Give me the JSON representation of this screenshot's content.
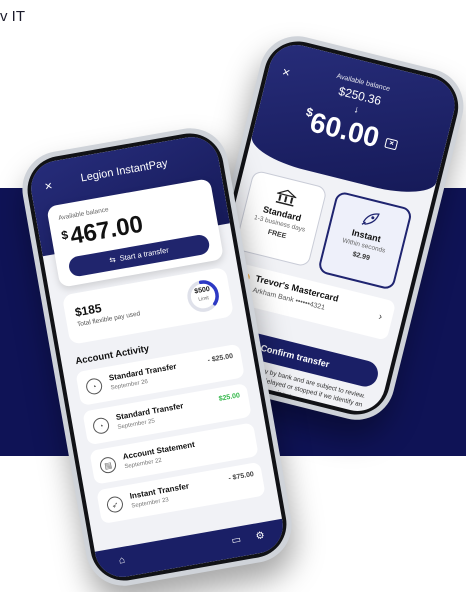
{
  "page_label": "v IT",
  "back_screen": {
    "close_icon": "×",
    "available_label": "Available balance",
    "old_balance": "$250.36",
    "arrow": "↓",
    "new_currency": "$",
    "new_amount": "60.00",
    "options": [
      {
        "title": "Standard",
        "sub": "1-3 business days",
        "price": "FREE",
        "icon": "bank-icon"
      },
      {
        "title": "Instant",
        "sub": "Within seconds",
        "price": "$2.99",
        "icon": "rocket-icon"
      }
    ],
    "card": {
      "name": "Trevor's Mastercard",
      "account": "Arkham Bank ••••••4321"
    },
    "confirm_label": "Confirm transfer",
    "disclaimer": "Transfer times vary by bank and are subject to review. Transfers may be delayed or stopped if we identify an issue."
  },
  "front_screen": {
    "title": "Legion InstantPay",
    "close_icon": "×",
    "available_label": "Available balance",
    "currency": "$",
    "balance": "467.00",
    "start_transfer_label": "Start a transfer",
    "flex_amount": "$185",
    "flex_label": "Total flexible pay used",
    "ring_value": "$500",
    "ring_sub": "Limit",
    "ring_fraction": 0.37,
    "activity_title": "Account Activity",
    "activity": [
      {
        "name": "Standard Transfer",
        "date": "September 26",
        "amount": "- $25.00",
        "tone": "neg",
        "icon": "clock-icon"
      },
      {
        "name": "Standard Transfer",
        "date": "September 25",
        "amount": "$25.00",
        "tone": "pos",
        "icon": "clock-icon"
      },
      {
        "name": "Account Statement",
        "date": "September 22",
        "amount": "",
        "tone": "neg",
        "icon": "document-icon"
      },
      {
        "name": "Instant Transfer",
        "date": "September 23",
        "amount": "- $75.00",
        "tone": "neg",
        "icon": "rocket-icon"
      }
    ]
  },
  "colors": {
    "band": "#0f1356",
    "accent": "#1a1f66",
    "positive": "#33b84a"
  }
}
